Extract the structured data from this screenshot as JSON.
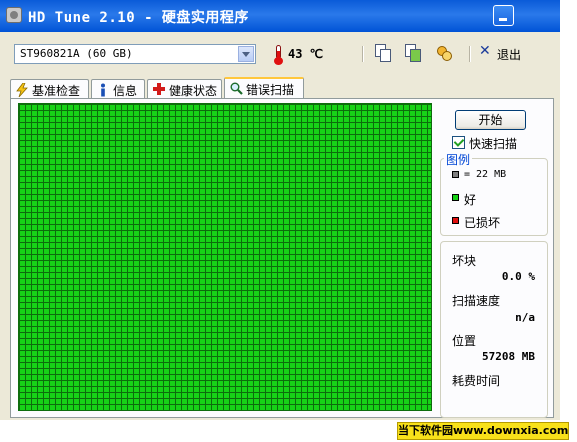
{
  "window": {
    "title": "HD Tune 2.10 - 硬盘实用程序"
  },
  "toolbar": {
    "drive_select": "ST960821A (60 GB)",
    "temperature": "43 ℃",
    "exit_label": "退出"
  },
  "tabs": [
    {
      "label": "基准检查",
      "icon": "bolt-icon",
      "active": false
    },
    {
      "label": "信息",
      "icon": "info-icon",
      "active": false
    },
    {
      "label": "健康状态",
      "icon": "health-cross-icon",
      "active": false
    },
    {
      "label": "错误扫描",
      "icon": "magnifier-icon",
      "active": true
    }
  ],
  "controls": {
    "start_button": "开始",
    "quick_scan_label": "快速扫描",
    "quick_scan_checked": true
  },
  "legend": {
    "title": "图例",
    "items": [
      {
        "label": "= 22 MB",
        "color": "#808080"
      },
      {
        "label": "好",
        "color": "#17d317"
      },
      {
        "label": "已损坏",
        "color": "#e01010"
      }
    ]
  },
  "stats": {
    "bad_blocks_label": "坏块",
    "bad_blocks_value": "0.0 %",
    "scan_speed_label": "扫描速度",
    "scan_speed_value": "n/a",
    "position_label": "位置",
    "position_value": "57208 MB",
    "elapsed_label": "耗费时间"
  },
  "colors": {
    "good_block": "#17d317",
    "grid_line": "#0d6d0d",
    "title_bar": "#0a5bd8"
  },
  "watermark": "当下软件园www.downxia.com"
}
